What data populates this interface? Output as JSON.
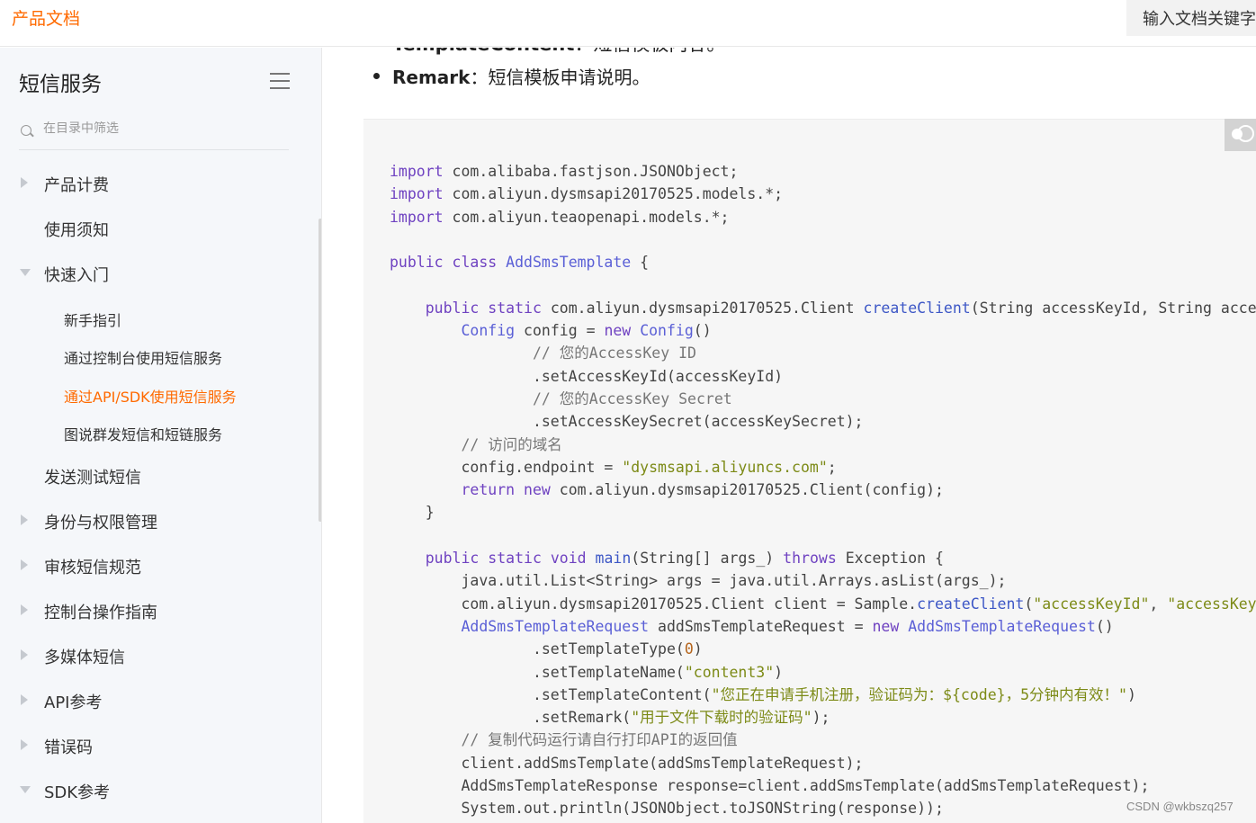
{
  "header": {
    "brand": "产品文档",
    "search_placeholder": "输入文档关键字查"
  },
  "sidebar": {
    "title": "短信服务",
    "filter_placeholder": "在目录中筛选",
    "items": [
      {
        "label": "产品计费",
        "arrow": "right",
        "level": 1
      },
      {
        "label": "使用须知",
        "arrow": "none",
        "level": 1
      },
      {
        "label": "快速入门",
        "arrow": "down",
        "level": 1
      },
      {
        "label": "新手指引",
        "arrow": "none",
        "level": 2
      },
      {
        "label": "通过控制台使用短信服务",
        "arrow": "none",
        "level": 2
      },
      {
        "label": "通过API/SDK使用短信服务",
        "arrow": "none",
        "level": 2,
        "active": true
      },
      {
        "label": "图说群发短信和短链服务",
        "arrow": "none",
        "level": 2
      },
      {
        "label": "发送测试短信",
        "arrow": "none",
        "level": 1
      },
      {
        "label": "身份与权限管理",
        "arrow": "right",
        "level": 1
      },
      {
        "label": "审核短信规范",
        "arrow": "right",
        "level": 1
      },
      {
        "label": "控制台操作指南",
        "arrow": "right",
        "level": 1
      },
      {
        "label": "多媒体短信",
        "arrow": "right",
        "level": 1
      },
      {
        "label": "API参考",
        "arrow": "right",
        "level": 1
      },
      {
        "label": "错误码",
        "arrow": "right",
        "level": 1
      },
      {
        "label": "SDK参考",
        "arrow": "down",
        "level": 1
      }
    ]
  },
  "content": {
    "cut_line_term": "TemplateContent",
    "cut_line_text": "：短信模板内容。",
    "remark_term": "Remark",
    "remark_text": "：短信模板申请说明。",
    "code_lines": [
      "import com.alibaba.fastjson.JSONObject;",
      "import com.aliyun.dysmsapi20170525.models.*;",
      "import com.aliyun.teaopenapi.models.*;",
      "",
      "public class AddSmsTemplate {",
      "",
      "    public static com.aliyun.dysmsapi20170525.Client createClient(String accessKeyId, String accessKeySecret) throws Exception {",
      "        Config config = new Config()",
      "                // 您的AccessKey ID",
      "                .setAccessKeyId(accessKeyId)",
      "                // 您的AccessKey Secret",
      "                .setAccessKeySecret(accessKeySecret);",
      "        // 访问的域名",
      "        config.endpoint = \"dysmsapi.aliyuncs.com\";",
      "        return new com.aliyun.dysmsapi20170525.Client(config);",
      "    }",
      "",
      "    public static void main(String[] args_) throws Exception {",
      "        java.util.List<String> args = java.util.Arrays.asList(args_);",
      "        com.aliyun.dysmsapi20170525.Client client = Sample.createClient(\"accessKeyId\", \"accessKeySecret\");",
      "        AddSmsTemplateRequest addSmsTemplateRequest = new AddSmsTemplateRequest()",
      "                .setTemplateType(0)",
      "                .setTemplateName(\"content3\")",
      "                .setTemplateContent(\"您正在申请手机注册，验证码为：${code}，5分钟内有效！\")",
      "                .setRemark(\"用于文件下载时的验证码\");",
      "        // 复制代码运行请自行打印API的返回值",
      "        client.addSmsTemplate(addSmsTemplateRequest);",
      "        AddSmsTemplateResponse response=client.addSmsTemplate(addSmsTemplateRequest);",
      "        System.out.println(JSONObject.toJSONString(response));"
    ]
  },
  "watermark": "CSDN @wkbszq257",
  "colors": {
    "accent": "#ff6a00",
    "keyword": "#6f42c1",
    "string": "#7c8a16",
    "comment": "#777777"
  },
  "icons": {
    "menu": "hamburger-icon",
    "filter": "search-icon",
    "toggle": "theme-toggle-icon"
  }
}
